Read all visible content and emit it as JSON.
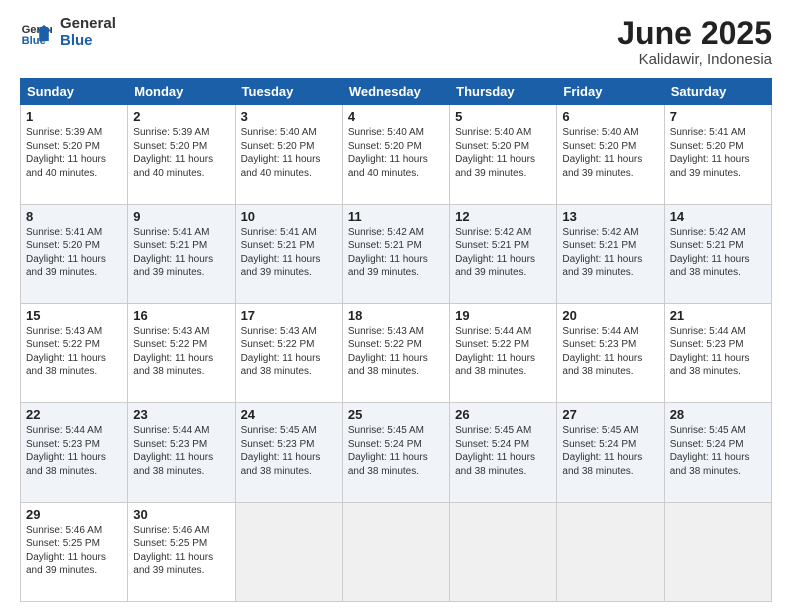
{
  "header": {
    "logo_line1": "General",
    "logo_line2": "Blue",
    "month_title": "June 2025",
    "location": "Kalidawir, Indonesia"
  },
  "days_of_week": [
    "Sunday",
    "Monday",
    "Tuesday",
    "Wednesday",
    "Thursday",
    "Friday",
    "Saturday"
  ],
  "weeks": [
    [
      {
        "day": "1",
        "text": "Sunrise: 5:39 AM\nSunset: 5:20 PM\nDaylight: 11 hours\nand 40 minutes."
      },
      {
        "day": "2",
        "text": "Sunrise: 5:39 AM\nSunset: 5:20 PM\nDaylight: 11 hours\nand 40 minutes."
      },
      {
        "day": "3",
        "text": "Sunrise: 5:40 AM\nSunset: 5:20 PM\nDaylight: 11 hours\nand 40 minutes."
      },
      {
        "day": "4",
        "text": "Sunrise: 5:40 AM\nSunset: 5:20 PM\nDaylight: 11 hours\nand 40 minutes."
      },
      {
        "day": "5",
        "text": "Sunrise: 5:40 AM\nSunset: 5:20 PM\nDaylight: 11 hours\nand 39 minutes."
      },
      {
        "day": "6",
        "text": "Sunrise: 5:40 AM\nSunset: 5:20 PM\nDaylight: 11 hours\nand 39 minutes."
      },
      {
        "day": "7",
        "text": "Sunrise: 5:41 AM\nSunset: 5:20 PM\nDaylight: 11 hours\nand 39 minutes."
      }
    ],
    [
      {
        "day": "8",
        "text": "Sunrise: 5:41 AM\nSunset: 5:20 PM\nDaylight: 11 hours\nand 39 minutes."
      },
      {
        "day": "9",
        "text": "Sunrise: 5:41 AM\nSunset: 5:21 PM\nDaylight: 11 hours\nand 39 minutes."
      },
      {
        "day": "10",
        "text": "Sunrise: 5:41 AM\nSunset: 5:21 PM\nDaylight: 11 hours\nand 39 minutes."
      },
      {
        "day": "11",
        "text": "Sunrise: 5:42 AM\nSunset: 5:21 PM\nDaylight: 11 hours\nand 39 minutes."
      },
      {
        "day": "12",
        "text": "Sunrise: 5:42 AM\nSunset: 5:21 PM\nDaylight: 11 hours\nand 39 minutes."
      },
      {
        "day": "13",
        "text": "Sunrise: 5:42 AM\nSunset: 5:21 PM\nDaylight: 11 hours\nand 39 minutes."
      },
      {
        "day": "14",
        "text": "Sunrise: 5:42 AM\nSunset: 5:21 PM\nDaylight: 11 hours\nand 38 minutes."
      }
    ],
    [
      {
        "day": "15",
        "text": "Sunrise: 5:43 AM\nSunset: 5:22 PM\nDaylight: 11 hours\nand 38 minutes."
      },
      {
        "day": "16",
        "text": "Sunrise: 5:43 AM\nSunset: 5:22 PM\nDaylight: 11 hours\nand 38 minutes."
      },
      {
        "day": "17",
        "text": "Sunrise: 5:43 AM\nSunset: 5:22 PM\nDaylight: 11 hours\nand 38 minutes."
      },
      {
        "day": "18",
        "text": "Sunrise: 5:43 AM\nSunset: 5:22 PM\nDaylight: 11 hours\nand 38 minutes."
      },
      {
        "day": "19",
        "text": "Sunrise: 5:44 AM\nSunset: 5:22 PM\nDaylight: 11 hours\nand 38 minutes."
      },
      {
        "day": "20",
        "text": "Sunrise: 5:44 AM\nSunset: 5:23 PM\nDaylight: 11 hours\nand 38 minutes."
      },
      {
        "day": "21",
        "text": "Sunrise: 5:44 AM\nSunset: 5:23 PM\nDaylight: 11 hours\nand 38 minutes."
      }
    ],
    [
      {
        "day": "22",
        "text": "Sunrise: 5:44 AM\nSunset: 5:23 PM\nDaylight: 11 hours\nand 38 minutes."
      },
      {
        "day": "23",
        "text": "Sunrise: 5:44 AM\nSunset: 5:23 PM\nDaylight: 11 hours\nand 38 minutes."
      },
      {
        "day": "24",
        "text": "Sunrise: 5:45 AM\nSunset: 5:23 PM\nDaylight: 11 hours\nand 38 minutes."
      },
      {
        "day": "25",
        "text": "Sunrise: 5:45 AM\nSunset: 5:24 PM\nDaylight: 11 hours\nand 38 minutes."
      },
      {
        "day": "26",
        "text": "Sunrise: 5:45 AM\nSunset: 5:24 PM\nDaylight: 11 hours\nand 38 minutes."
      },
      {
        "day": "27",
        "text": "Sunrise: 5:45 AM\nSunset: 5:24 PM\nDaylight: 11 hours\nand 38 minutes."
      },
      {
        "day": "28",
        "text": "Sunrise: 5:45 AM\nSunset: 5:24 PM\nDaylight: 11 hours\nand 38 minutes."
      }
    ],
    [
      {
        "day": "29",
        "text": "Sunrise: 5:46 AM\nSunset: 5:25 PM\nDaylight: 11 hours\nand 39 minutes."
      },
      {
        "day": "30",
        "text": "Sunrise: 5:46 AM\nSunset: 5:25 PM\nDaylight: 11 hours\nand 39 minutes."
      },
      {
        "day": "",
        "text": ""
      },
      {
        "day": "",
        "text": ""
      },
      {
        "day": "",
        "text": ""
      },
      {
        "day": "",
        "text": ""
      },
      {
        "day": "",
        "text": ""
      }
    ]
  ]
}
